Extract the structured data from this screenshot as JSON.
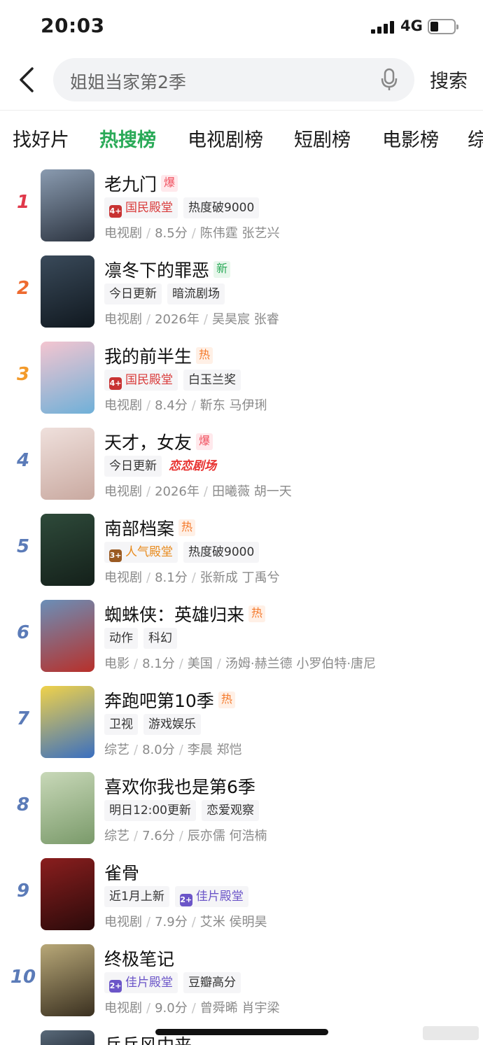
{
  "status_bar": {
    "time": "20:03",
    "network": "4G"
  },
  "search": {
    "query": "姐姐当家第2季",
    "button_label": "搜索"
  },
  "tabs": [
    {
      "label": "找好片",
      "active": false
    },
    {
      "label": "热搜榜",
      "active": true
    },
    {
      "label": "电视剧榜",
      "active": false
    },
    {
      "label": "短剧榜",
      "active": false
    },
    {
      "label": "电影榜",
      "active": false
    },
    {
      "label": "综",
      "active": false
    }
  ],
  "rank_colors": {
    "top1": "#e0384a",
    "top2": "#ee6a2f",
    "top3": "#f39a2a",
    "rest": "#5b7bb8"
  },
  "items": [
    {
      "rank": "1",
      "title": "老九门",
      "badge": "爆",
      "badge_type": "boom",
      "tags": [
        {
          "text": "国民殿堂",
          "style": "red",
          "icon": "4+"
        },
        {
          "text": "热度破9000",
          "style": "plain"
        }
      ],
      "meta": [
        "电视剧",
        "8.5分",
        "陈伟霆 张艺兴"
      ]
    },
    {
      "rank": "2",
      "title": "凛冬下的罪恶",
      "badge": "新",
      "badge_type": "new",
      "tags": [
        {
          "text": "今日更新",
          "style": "plain"
        },
        {
          "text": "暗流剧场",
          "style": "plain"
        }
      ],
      "meta": [
        "电视剧",
        "2026年",
        "吴昊宸 张睿"
      ]
    },
    {
      "rank": "3",
      "title": "我的前半生",
      "badge": "热",
      "badge_type": "hot",
      "tags": [
        {
          "text": "国民殿堂",
          "style": "red",
          "icon": "4+"
        },
        {
          "text": "白玉兰奖",
          "style": "plain"
        }
      ],
      "meta": [
        "电视剧",
        "8.4分",
        "靳东 马伊琍"
      ]
    },
    {
      "rank": "4",
      "title": "天才，女友",
      "badge": "爆",
      "badge_type": "boom",
      "tags": [
        {
          "text": "今日更新",
          "style": "plain"
        },
        {
          "text": "恋恋剧场",
          "style": "script"
        }
      ],
      "meta": [
        "电视剧",
        "2026年",
        "田曦薇 胡一天"
      ]
    },
    {
      "rank": "5",
      "title": "南部档案",
      "badge": "热",
      "badge_type": "hot",
      "tags": [
        {
          "text": "人气殿堂",
          "style": "orange",
          "icon": "3+"
        },
        {
          "text": "热度破9000",
          "style": "plain"
        }
      ],
      "meta": [
        "电视剧",
        "8.1分",
        "张新成 丁禹兮"
      ]
    },
    {
      "rank": "6",
      "title": "蜘蛛侠：英雄归来",
      "badge": "热",
      "badge_type": "hot",
      "tags": [
        {
          "text": "动作",
          "style": "plain"
        },
        {
          "text": "科幻",
          "style": "plain"
        }
      ],
      "meta": [
        "电影",
        "8.1分",
        "美国",
        "汤姆·赫兰德 小罗伯特·唐尼"
      ]
    },
    {
      "rank": "7",
      "title": "奔跑吧第10季",
      "badge": "热",
      "badge_type": "hot",
      "tags": [
        {
          "text": "卫视",
          "style": "plain"
        },
        {
          "text": "游戏娱乐",
          "style": "plain"
        }
      ],
      "meta": [
        "综艺",
        "8.0分",
        "李晨 郑恺"
      ]
    },
    {
      "rank": "8",
      "title": "喜欢你我也是第6季",
      "badge": "",
      "badge_type": "",
      "tags": [
        {
          "text": "明日12:00更新",
          "style": "plain"
        },
        {
          "text": "恋爱观察",
          "style": "plain"
        }
      ],
      "meta": [
        "综艺",
        "7.6分",
        "辰亦儒 何浩楠"
      ]
    },
    {
      "rank": "9",
      "title": "雀骨",
      "badge": "",
      "badge_type": "",
      "tags": [
        {
          "text": "近1月上新",
          "style": "plain"
        },
        {
          "text": "佳片殿堂",
          "style": "purple",
          "icon": "2+"
        }
      ],
      "meta": [
        "电视剧",
        "7.9分",
        "艾米 侯明昊"
      ]
    },
    {
      "rank": "10",
      "title": "终极笔记",
      "badge": "",
      "badge_type": "",
      "tags": [
        {
          "text": "佳片殿堂",
          "style": "purple",
          "icon": "2+"
        },
        {
          "text": "豆瓣高分",
          "style": "plain"
        }
      ],
      "meta": [
        "电视剧",
        "9.0分",
        "曾舜晞 肖宇梁"
      ]
    }
  ],
  "peek_item": {
    "title": "乒乓风中来"
  }
}
